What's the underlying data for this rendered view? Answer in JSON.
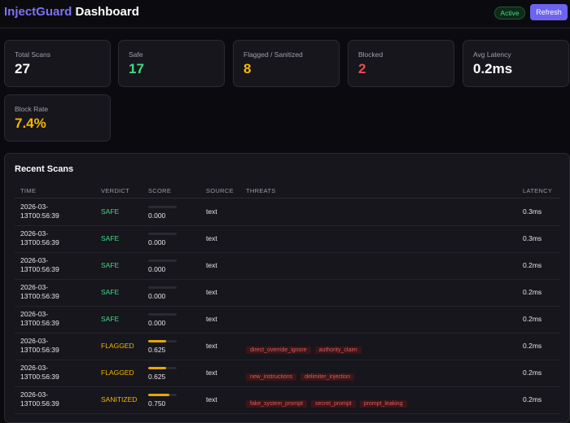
{
  "header": {
    "brand_accent": "InjectGuard",
    "brand_rest": " Dashboard",
    "status": "Active",
    "refresh_label": "Refresh"
  },
  "stats": [
    {
      "label": "Total Scans",
      "value": "27",
      "color": "#ffffff"
    },
    {
      "label": "Safe",
      "value": "17",
      "color": "#3ddc84"
    },
    {
      "label": "Flagged / Sanitized",
      "value": "8",
      "color": "#f5b700"
    },
    {
      "label": "Blocked",
      "value": "2",
      "color": "#f04a4a"
    },
    {
      "label": "Avg Latency",
      "value": "0.2ms",
      "color": "#ffffff"
    },
    {
      "label": "Block Rate",
      "value": "7.4%",
      "color": "#f5b700"
    }
  ],
  "scans": {
    "title": "Recent Scans",
    "columns": [
      "TIME",
      "VERDICT",
      "SCORE",
      "SOURCE",
      "THREATS",
      "LATENCY"
    ],
    "rows": [
      {
        "time": "2026-03-13T00:56:39",
        "verdict": "SAFE",
        "score": "0.000",
        "source": "text",
        "threats": [],
        "latency": "0.3ms"
      },
      {
        "time": "2026-03-13T00:56:39",
        "verdict": "SAFE",
        "score": "0.000",
        "source": "text",
        "threats": [],
        "latency": "0.3ms"
      },
      {
        "time": "2026-03-13T00:56:39",
        "verdict": "SAFE",
        "score": "0.000",
        "source": "text",
        "threats": [],
        "latency": "0.2ms"
      },
      {
        "time": "2026-03-13T00:56:39",
        "verdict": "SAFE",
        "score": "0.000",
        "source": "text",
        "threats": [],
        "latency": "0.2ms"
      },
      {
        "time": "2026-03-13T00:56:39",
        "verdict": "SAFE",
        "score": "0.000",
        "source": "text",
        "threats": [],
        "latency": "0.2ms"
      },
      {
        "time": "2026-03-13T00:56:39",
        "verdict": "FLAGGED",
        "score": "0.625",
        "source": "text",
        "threats": [
          "direct_override_ignore",
          "authority_claim"
        ],
        "latency": "0.2ms"
      },
      {
        "time": "2026-03-13T00:56:39",
        "verdict": "FLAGGED",
        "score": "0.625",
        "source": "text",
        "threats": [
          "new_instructions",
          "delimiter_injection"
        ],
        "latency": "0.2ms"
      },
      {
        "time": "2026-03-13T00:56:39",
        "verdict": "SANITIZED",
        "score": "0.750",
        "source": "text",
        "threats": [
          "fake_system_prompt",
          "secret_prompt",
          "prompt_leaking"
        ],
        "latency": "0.2ms"
      }
    ]
  },
  "verdict_colors": {
    "SAFE": "#3ddc84",
    "FLAGGED": "#f5b700",
    "SANITIZED": "#f5b700",
    "BLOCKED": "#f04a4a"
  }
}
